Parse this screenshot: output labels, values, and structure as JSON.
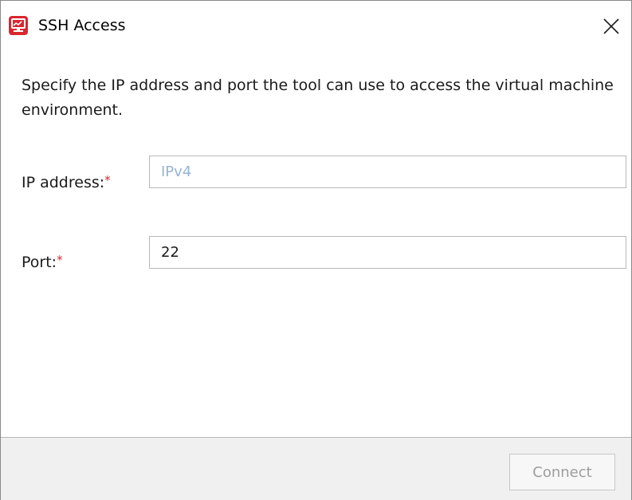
{
  "window": {
    "title": "SSH Access",
    "icon": "ssh-monitor-icon",
    "close_icon": "close-icon"
  },
  "main": {
    "description": "Specify the IP address and port the tool can use to access the virtual machine environment.",
    "fields": [
      {
        "label": "IP address:",
        "required_mark": "*",
        "value": "",
        "placeholder": "IPv4"
      },
      {
        "label": "Port:",
        "required_mark": "*",
        "value": "22",
        "placeholder": ""
      }
    ]
  },
  "footer": {
    "connect_label": "Connect",
    "connect_enabled": false
  },
  "colors": {
    "required": "#e0262e",
    "placeholder": "#97b4d4",
    "icon_red": "#d9272e",
    "footer_bg": "#f0f0f0",
    "disabled_text": "#9d9d9d"
  }
}
